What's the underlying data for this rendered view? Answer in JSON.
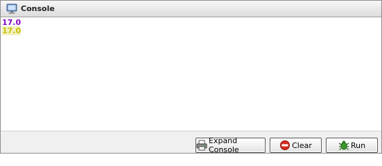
{
  "header": {
    "title": "Console",
    "icon": "monitor-icon"
  },
  "console": {
    "lines": [
      {
        "text": "17.0",
        "color": "#8a00c8"
      },
      {
        "text": "17.0",
        "color": "#c8c200",
        "highlight": "#f3f0c0"
      }
    ]
  },
  "footer": {
    "expand_label": "Expand Console",
    "expand_icon": "printer-icon",
    "clear_label": "Clear",
    "clear_icon": "no-entry-icon",
    "run_label": "Run",
    "run_icon": "bug-icon"
  }
}
